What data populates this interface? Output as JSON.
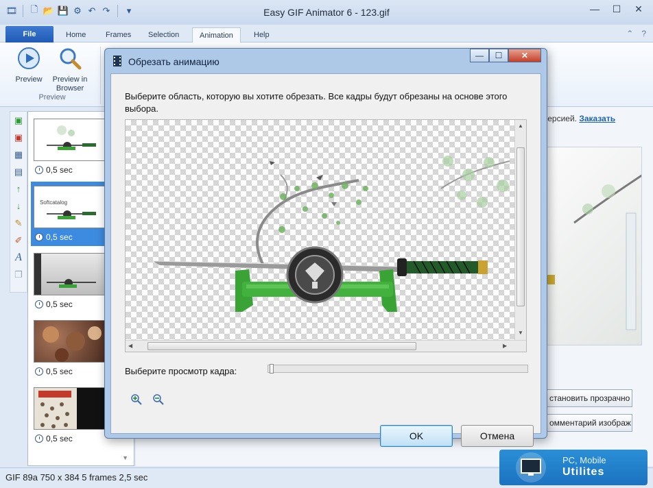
{
  "app": {
    "title": "Easy GIF Animator 6 - 123.gif"
  },
  "window_controls": {
    "minimize": "—",
    "maximize": "☐",
    "close": "✕"
  },
  "ribbon_tabs": [
    "File",
    "Home",
    "Frames",
    "Selection",
    "Animation",
    "Help"
  ],
  "ribbon": {
    "preview_label": "Preview",
    "preview_browser_line1": "Preview in",
    "preview_browser_line2": "Browser",
    "group_label": "Preview"
  },
  "frames": [
    {
      "duration": "0,5 sec"
    },
    {
      "duration": "0,5 sec"
    },
    {
      "duration": "0,5 sec"
    },
    {
      "duration": "0,5 sec"
    },
    {
      "duration": "0,5 sec"
    }
  ],
  "frame2_caption": "Softcatalog",
  "registration": {
    "text": "версией.",
    "link": "Заказать"
  },
  "background_buttons": [
    "становить прозрачно",
    "омментарий изображ"
  ],
  "statusbar": {
    "text": "GIF 89a 750 x 384 5 frames 2,5 sec"
  },
  "watermark": {
    "line1": "PC, Mobile",
    "line2": "Utilites"
  },
  "dialog": {
    "title": "Обрезать анимацию",
    "description": "Выберите область, которую вы хотите обрезать. Все кадры будут обрезаны на основе этого выбора.",
    "frame_label": "Выберите просмотр кадра:",
    "ok_label": "OK",
    "cancel_label": "Отмена"
  },
  "colors": {
    "accent": "#1f5ab5",
    "selection": "#3c8be0",
    "katana_green": "#3aa336"
  }
}
